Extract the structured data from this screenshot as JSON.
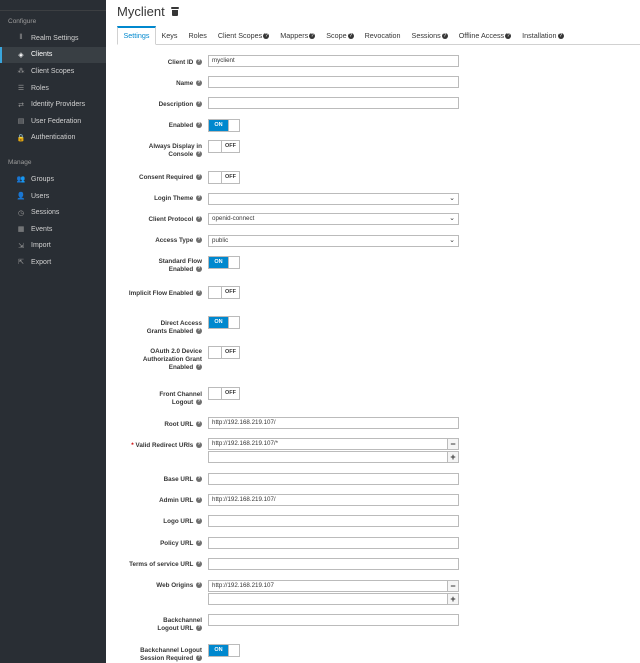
{
  "sidebar": {
    "configure_label": "Configure",
    "manage_label": "Manage",
    "configure_items": [
      {
        "label": "Realm Settings",
        "icon": "sliders-icon",
        "glyph": "⫴"
      },
      {
        "label": "Clients",
        "icon": "cube-icon",
        "glyph": "◈"
      },
      {
        "label": "Client Scopes",
        "icon": "cubes-icon",
        "glyph": "⁂"
      },
      {
        "label": "Roles",
        "icon": "list-icon",
        "glyph": "☰"
      },
      {
        "label": "Identity Providers",
        "icon": "exchange-icon",
        "glyph": "⇄"
      },
      {
        "label": "User Federation",
        "icon": "database-icon",
        "glyph": "▤"
      },
      {
        "label": "Authentication",
        "icon": "lock-icon",
        "glyph": "🔒"
      }
    ],
    "manage_items": [
      {
        "label": "Groups",
        "icon": "users-icon",
        "glyph": "👥"
      },
      {
        "label": "Users",
        "icon": "user-icon",
        "glyph": "👤"
      },
      {
        "label": "Sessions",
        "icon": "clock-icon",
        "glyph": "◷"
      },
      {
        "label": "Events",
        "icon": "calendar-icon",
        "glyph": "▦"
      },
      {
        "label": "Import",
        "icon": "import-icon",
        "glyph": "⇲"
      },
      {
        "label": "Export",
        "icon": "export-icon",
        "glyph": "⇱"
      }
    ],
    "active": "Clients"
  },
  "page": {
    "title": "Myclient"
  },
  "tabs": [
    {
      "label": "Settings",
      "help": false
    },
    {
      "label": "Keys",
      "help": false
    },
    {
      "label": "Roles",
      "help": false
    },
    {
      "label": "Client Scopes",
      "help": true
    },
    {
      "label": "Mappers",
      "help": true
    },
    {
      "label": "Scope",
      "help": true
    },
    {
      "label": "Revocation",
      "help": false
    },
    {
      "label": "Sessions",
      "help": true
    },
    {
      "label": "Offline Access",
      "help": true
    },
    {
      "label": "Installation",
      "help": true
    }
  ],
  "form": {
    "client_id": {
      "label": "Client ID",
      "value": "myclient"
    },
    "name": {
      "label": "Name",
      "value": ""
    },
    "description": {
      "label": "Description",
      "value": ""
    },
    "enabled": {
      "label": "Enabled",
      "state": "ON"
    },
    "always_display": {
      "label": "Always Display in Console",
      "state": "OFF"
    },
    "consent_required": {
      "label": "Consent Required",
      "state": "OFF"
    },
    "login_theme": {
      "label": "Login Theme",
      "value": ""
    },
    "client_protocol": {
      "label": "Client Protocol",
      "value": "openid-connect"
    },
    "access_type": {
      "label": "Access Type",
      "value": "public"
    },
    "standard_flow": {
      "label": "Standard Flow Enabled",
      "state": "ON"
    },
    "implicit_flow": {
      "label": "Implicit Flow Enabled",
      "state": "OFF"
    },
    "direct_access": {
      "label": "Direct Access Grants Enabled",
      "state": "ON"
    },
    "device_grant": {
      "label": "OAuth 2.0 Device Authorization Grant Enabled",
      "state": "OFF"
    },
    "front_channel": {
      "label": "Front Channel Logout",
      "state": "OFF"
    },
    "root_url": {
      "label": "Root URL",
      "value": "http://192.168.219.107/"
    },
    "redirect_uris": {
      "label": "Valid Redirect URIs",
      "required_mark": "*",
      "value": "http://192.168.219.107/*",
      "value2": ""
    },
    "base_url": {
      "label": "Base URL",
      "value": ""
    },
    "admin_url": {
      "label": "Admin URL",
      "value": "http://192.168.219.107/"
    },
    "logo_url": {
      "label": "Logo URL",
      "value": ""
    },
    "policy_url": {
      "label": "Policy URL",
      "value": ""
    },
    "tos_url": {
      "label": "Terms of service URL",
      "value": ""
    },
    "web_origins": {
      "label": "Web Origins",
      "value": "http://192.168.219.107",
      "value2": ""
    },
    "backchannel_url": {
      "label": "Backchannel Logout URL",
      "value": ""
    },
    "backchannel_session": {
      "label": "Backchannel Logout Session Required",
      "state": "ON"
    }
  },
  "glyphs": {
    "help": "?",
    "chevron": "⌄",
    "minus": "−",
    "plus": "+"
  }
}
